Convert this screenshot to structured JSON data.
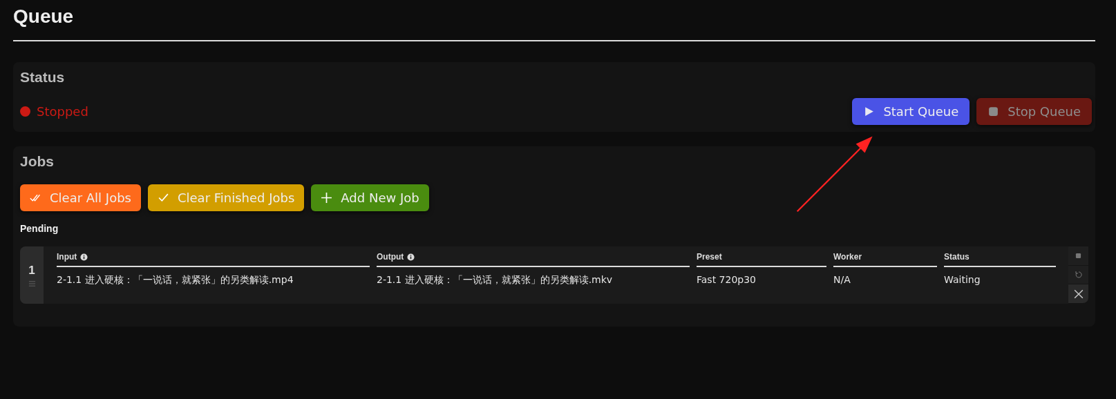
{
  "title": "Queue",
  "status_panel": {
    "title": "Status",
    "state": {
      "text": "Stopped",
      "color": "#cc1a14"
    },
    "buttons": [
      {
        "kind": "start",
        "label": "Start Queue",
        "disabled": false
      },
      {
        "kind": "stop",
        "label": "Stop Queue",
        "disabled": true
      }
    ]
  },
  "jobs_panel": {
    "title": "Jobs",
    "buttons": [
      {
        "kind": "clear-all",
        "label": "Clear All Jobs"
      },
      {
        "kind": "clear-finished",
        "label": "Clear Finished Jobs"
      },
      {
        "kind": "add",
        "label": "Add New Job"
      }
    ],
    "section": "Pending",
    "jobs": [
      {
        "index": "1",
        "columns": [
          {
            "header": "Input",
            "info": true,
            "value": "2-1.1 进入硬核：「一说话，就紧张」的另类解读.mp4"
          },
          {
            "header": "Output",
            "info": true,
            "value": "2-1.1 进入硬核：「一说话，就紧张」的另类解读.mkv"
          },
          {
            "header": "Preset",
            "info": false,
            "value": "Fast 720p30"
          },
          {
            "header": "Worker",
            "info": false,
            "value": "N/A"
          },
          {
            "header": "Status",
            "info": false,
            "value": "Waiting"
          }
        ]
      }
    ]
  }
}
